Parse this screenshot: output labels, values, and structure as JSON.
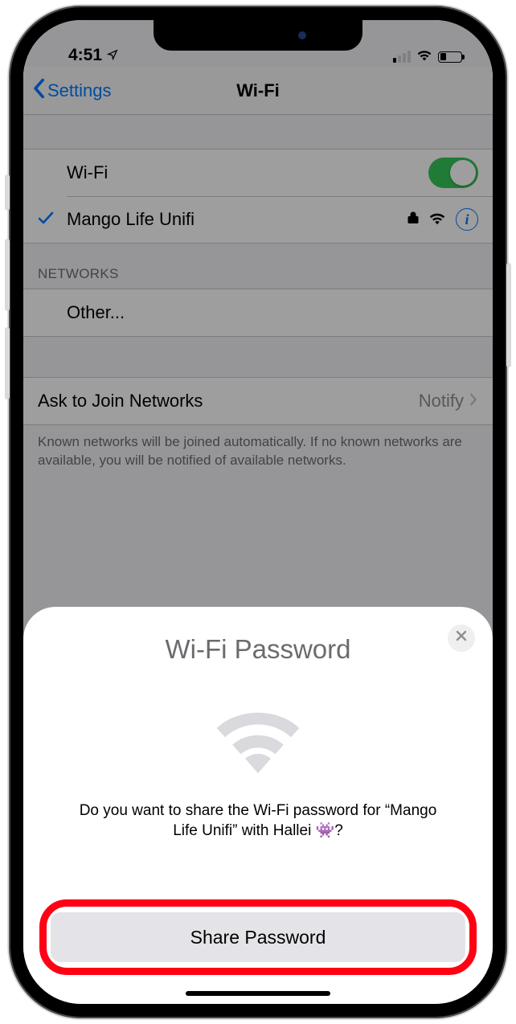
{
  "status": {
    "time": "4:51"
  },
  "nav": {
    "back": "Settings",
    "title": "Wi-Fi"
  },
  "wifi": {
    "toggle_label": "Wi-Fi",
    "connected_network": "Mango Life Unifi"
  },
  "networks_header": "NETWORKS",
  "other_label": "Other...",
  "ask_join": {
    "label": "Ask to Join Networks",
    "value": "Notify"
  },
  "footer": "Known networks will be joined automatically. If no known networks are available, you will be notified of available networks.",
  "sheet": {
    "title": "Wi-Fi Password",
    "message": "Do you want to share the Wi-Fi password for “Mango Life Unifi” with Hallei 👾?",
    "share_button": "Share Password"
  }
}
